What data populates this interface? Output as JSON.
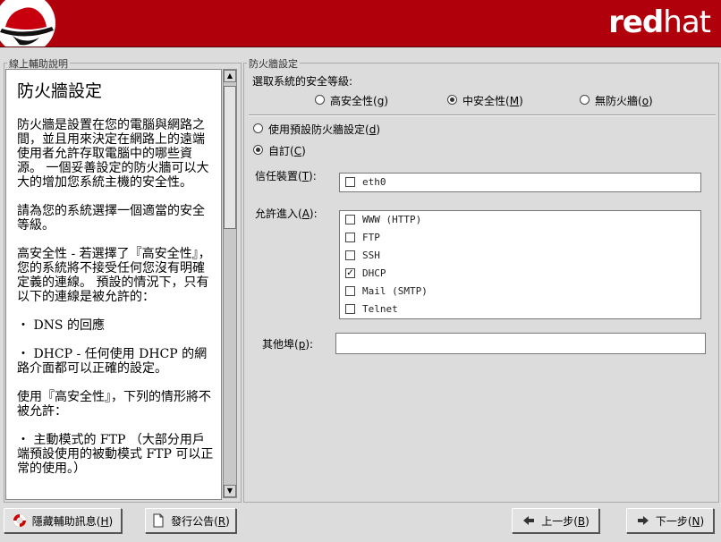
{
  "banner": {
    "brand_red": "red",
    "brand_hat": "hat",
    "color": "#b0000c"
  },
  "help_panel": {
    "group_label": "線上輔助說明",
    "title": "防火牆設定",
    "paragraphs": [
      "防火牆是設置在您的電腦與網路之間，並且用來決定在網路上的遠端使用者允許存取電腦中的哪些資源。 一個妥善設定的防火牆可以大大的增加您系統主機的安全性。",
      "請為您的系統選擇一個適當的安全等級。",
      "高安全性 - 若選擇了『高安全性』，您的系統將不接受任何您沒有明確定義的連線。 預設的情況下，只有以下的連線是被允許的：",
      "・ DNS 的回應",
      "・ DHCP - 任何使用 DHCP 的網路介面都可以正確的設定。",
      "使用『高安全性』，下列的情形將不被允許：",
      "・ 主動模式的 FTP （大部分用戶端預設使用的被動模式 FTP 可以正常的使用。）"
    ]
  },
  "firewall": {
    "group_label": "防火牆設定",
    "security_prompt": "選取系統的安全等級:",
    "levels": [
      {
        "label": "高安全性",
        "key": "g",
        "selected": false
      },
      {
        "label": "中安全性",
        "key": "M",
        "selected": true
      },
      {
        "label": "無防火牆",
        "key": "o",
        "selected": false
      }
    ],
    "mode_default": {
      "label": "使用預設防火牆設定",
      "key": "d",
      "selected": false
    },
    "mode_custom": {
      "label": "自訂",
      "key": "C",
      "selected": true
    },
    "trusted_label": "信任裝置",
    "trusted_key": "T",
    "trusted_devices": [
      {
        "name": "eth0",
        "checked": false
      }
    ],
    "allow_label": "允許進入",
    "allow_key": "A",
    "allow_services": [
      {
        "name": "WWW (HTTP)",
        "checked": false
      },
      {
        "name": "FTP",
        "checked": false
      },
      {
        "name": "SSH",
        "checked": false
      },
      {
        "name": "DHCP",
        "checked": true
      },
      {
        "name": "Mail (SMTP)",
        "checked": false
      },
      {
        "name": "Telnet",
        "checked": false
      }
    ],
    "other_ports_label": "其他埠",
    "other_ports_key": "p",
    "other_ports_value": ""
  },
  "buttons": {
    "hide_help": {
      "label": "隱藏輔助訊息",
      "key": "H"
    },
    "release_notes": {
      "label": "發行公告",
      "key": "R"
    },
    "back": {
      "label": "上一步",
      "key": "B"
    },
    "next": {
      "label": "下一步",
      "key": "N"
    }
  },
  "icons": [
    "redhat-logo-icon",
    "lifebuoy-icon",
    "document-icon",
    "arrow-left-icon",
    "arrow-right-icon",
    "scroll-up-icon",
    "scroll-down-icon"
  ]
}
